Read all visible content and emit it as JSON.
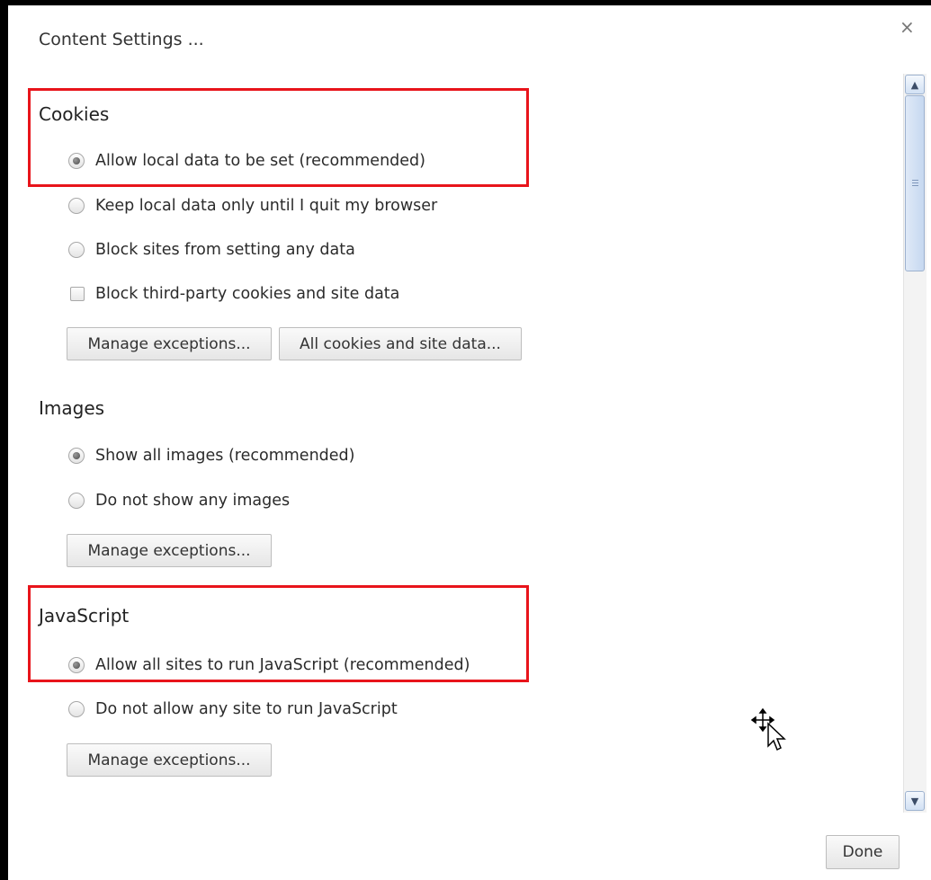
{
  "dialog": {
    "title": "Content Settings ...",
    "close_symbol": "×",
    "done_label": "Done"
  },
  "cookies": {
    "title": "Cookies",
    "options": [
      {
        "label": "Allow local data to be set (recommended)",
        "selected": true
      },
      {
        "label": "Keep local data only until I quit my browser",
        "selected": false
      },
      {
        "label": "Block sites from setting any data",
        "selected": false
      }
    ],
    "block_third_party": {
      "label": "Block third-party cookies and site data",
      "checked": false
    },
    "manage_exceptions_label": "Manage exceptions...",
    "all_cookies_label": "All cookies and site data..."
  },
  "images": {
    "title": "Images",
    "options": [
      {
        "label": "Show all images (recommended)",
        "selected": true
      },
      {
        "label": "Do not show any images",
        "selected": false
      }
    ],
    "manage_exceptions_label": "Manage exceptions..."
  },
  "javascript": {
    "title": "JavaScript",
    "options": [
      {
        "label": "Allow all sites to run JavaScript (recommended)",
        "selected": true
      },
      {
        "label": "Do not allow any site to run JavaScript",
        "selected": false
      }
    ],
    "manage_exceptions_label": "Manage exceptions..."
  },
  "icons": {
    "close": "close-icon",
    "scroll_up": "scroll-up-arrow-icon",
    "scroll_down": "scroll-down-arrow-icon",
    "cursor": "move-cursor-icon"
  },
  "colors": {
    "highlight": "#e8141b",
    "scrollbar_accent": "#9db2cf"
  }
}
